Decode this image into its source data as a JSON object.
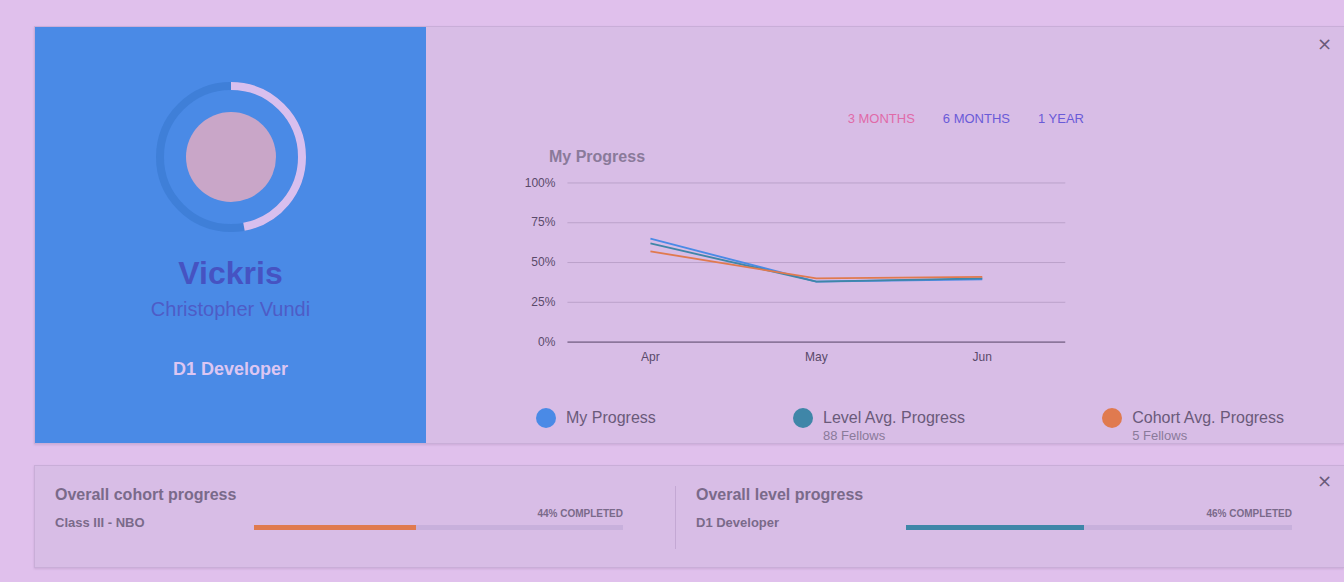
{
  "profile": {
    "nickname": "Vickris",
    "full_name": "Christopher Vundi",
    "level": "D1 Developer",
    "progress_ring": {
      "level": 0.47
    }
  },
  "progress_card": {
    "close": "×"
  },
  "chart": {
    "title": "My Progress",
    "ranges": [
      {
        "label": "3 MONTHS",
        "selected": true
      },
      {
        "label": "6 MONTHS",
        "selected": false
      },
      {
        "label": "1 YEAR",
        "selected": false
      }
    ],
    "y_ticks": [
      "100%",
      "75%",
      "50%",
      "25%",
      "0%"
    ],
    "x_labels": [
      "Apr",
      "May",
      "Jun"
    ],
    "series": [
      {
        "name": "My Progress",
        "color": "#4a8ae6",
        "values": [
          65,
          38,
          39.5
        ]
      },
      {
        "name": "Level Avg. Progress",
        "note": "88 Fellows",
        "color": "#3f86a8",
        "values": [
          62,
          38,
          40
        ]
      },
      {
        "name": "Cohort Avg. Progress",
        "note": "5 Fellows",
        "color": "#e07a4f",
        "values": [
          57,
          40,
          41
        ]
      }
    ]
  },
  "summary": {
    "close": "×",
    "items": [
      {
        "title": "Overall cohort progress",
        "label": "Class III - NBO",
        "reading": "44% COMPLETED",
        "level": 0.44,
        "color": "#e07a4f"
      },
      {
        "title": "Overall level progress",
        "label": "D1 Developer",
        "reading": "46% COMPLETED",
        "level": 0.46,
        "color": "#3f86a8"
      }
    ]
  }
}
